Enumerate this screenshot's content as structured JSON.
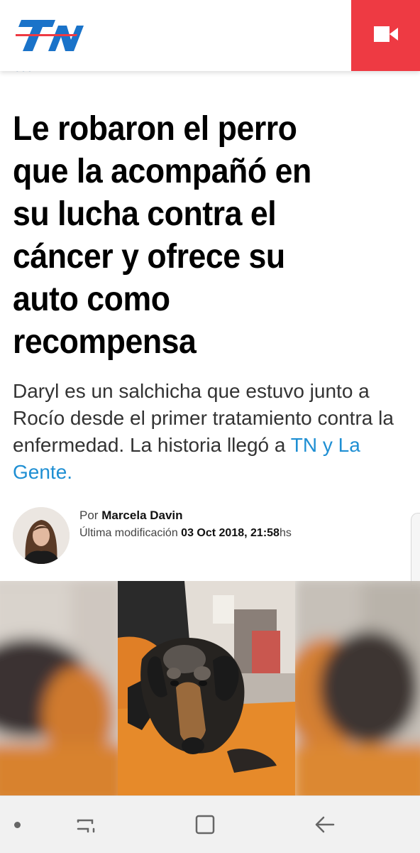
{
  "header": {
    "logo_text": "TN",
    "brand_color": "#1a73c9",
    "video_button_color": "#ee3a43",
    "video_icon": "video-camera-icon"
  },
  "article": {
    "headline": "Le robaron el perro que la acompañó en su lucha contra el cáncer y ofrece su auto como recompensa",
    "lead_text": "Daryl es un salchicha que estuvo junto a Rocío desde el primer tratamiento contra la enfermedad. La historia llegó a ",
    "lead_link": "TN y La Gente.",
    "link_color": "#1f8fd3"
  },
  "author": {
    "prefix": "Por",
    "name": "Marcela Davin",
    "modified_label": "Última modificación",
    "modified_date": "03 Oct 2018, 21:58",
    "modified_suffix": "hs"
  },
  "navbar": {
    "icons": [
      "dot-indicator-icon",
      "recent-apps-icon",
      "home-icon",
      "back-arrow-icon"
    ]
  }
}
